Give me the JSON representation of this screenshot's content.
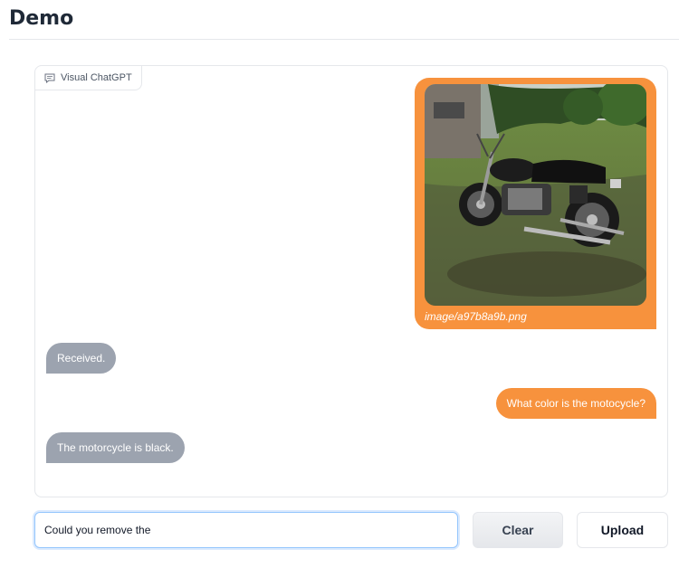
{
  "header": {
    "title": "Demo"
  },
  "chatbot": {
    "label": "Visual ChatGPT",
    "messages": [
      {
        "role": "user",
        "type": "image",
        "caption": "image/a97b8a9b.png"
      },
      {
        "role": "bot",
        "text": "Received."
      },
      {
        "role": "user",
        "text": "What color is the motocycle?"
      },
      {
        "role": "bot",
        "text": "The motorcycle is black."
      }
    ]
  },
  "input": {
    "value": "Could you remove the",
    "placeholder": ""
  },
  "buttons": {
    "clear": "Clear",
    "upload": "Upload"
  },
  "colors": {
    "user_bubble": "#f7923d",
    "bot_bubble": "#9ca3af",
    "input_focus": "#93c5fd"
  },
  "icons": {
    "chatbot_label": "chat-bubble-icon"
  }
}
